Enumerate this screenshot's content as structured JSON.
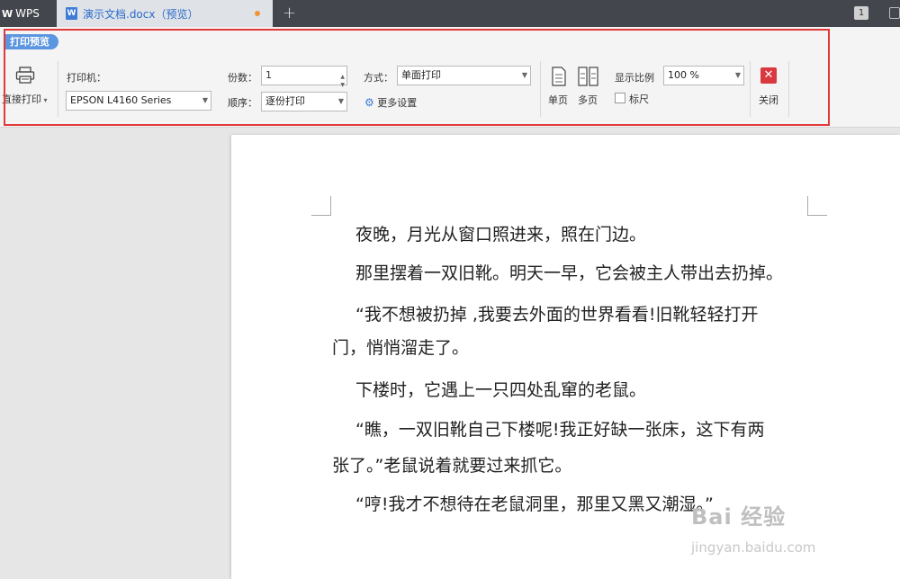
{
  "titlebar": {
    "app_name": "WPS",
    "doc_tab": "演示文档.docx（预览）",
    "new_tab": "+",
    "window_count": "1"
  },
  "toolbar": {
    "mode_label": "打印预览",
    "direct_print": "直接打印",
    "printer_label": "打印机：",
    "printer_value": "EPSON L4160 Series",
    "copies_label": "份数：",
    "copies_value": "1",
    "order_label": "顺序：",
    "order_value": "逐份打印",
    "method_label": "方式：",
    "method_value": "单面打印",
    "more_settings": "更多设置",
    "single_page": "单页",
    "multi_page": "多页",
    "zoom_label": "显示比例",
    "zoom_value": "100 %",
    "ruler_label": "标尺",
    "close_label": "关闭"
  },
  "document": {
    "paragraphs": [
      "夜晚，月光从窗口照进来，照在门边。",
      "那里摆着一双旧靴。明天一早，它会被主人带出去扔掉。",
      "“我不想被扔掉 ,我要去外面的世界看看!旧靴轻轻打开",
      "门，悄悄溜走了。",
      "下楼时，它遇上一只四处乱窜的老鼠。",
      "“瞧，一双旧靴自己下楼呢!我正好缺一张床，这下有两",
      "张了。”老鼠说着就要过来抓它。",
      "“哼!我才不想待在老鼠洞里，那里又黑又潮湿。”"
    ]
  },
  "watermark": {
    "text": "Bai 经验",
    "url": "jingyan.baidu.com"
  }
}
